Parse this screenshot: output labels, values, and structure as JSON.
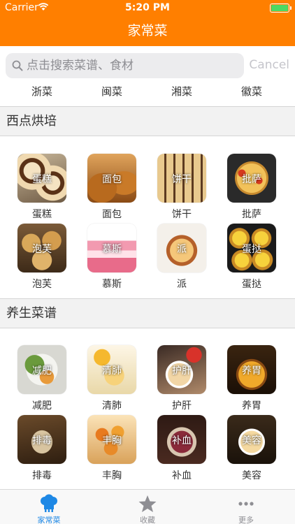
{
  "status": {
    "carrier": "Carrier",
    "time": "5:20 PM"
  },
  "nav": {
    "title": "家常菜"
  },
  "search": {
    "placeholder": "点击搜索菜谱、食材",
    "cancel": "Cancel"
  },
  "cuisines": [
    "浙菜",
    "闽菜",
    "湘菜",
    "徽菜"
  ],
  "sections": [
    {
      "title": "西点烘培",
      "items": [
        {
          "label": "蛋糕",
          "overlay": "蛋糕"
        },
        {
          "label": "面包",
          "overlay": "面包"
        },
        {
          "label": "饼干",
          "overlay": "饼干"
        },
        {
          "label": "批萨",
          "overlay": "批萨"
        },
        {
          "label": "泡芙",
          "overlay": "泡芙"
        },
        {
          "label": "慕斯",
          "overlay": "慕斯"
        },
        {
          "label": "派",
          "overlay": "派"
        },
        {
          "label": "蛋挞",
          "overlay": "蛋挞"
        }
      ]
    },
    {
      "title": "养生菜谱",
      "items": [
        {
          "label": "减肥",
          "overlay": "减肥"
        },
        {
          "label": "清肺",
          "overlay": "清肺"
        },
        {
          "label": "护肝",
          "overlay": "护肝"
        },
        {
          "label": "养胃",
          "overlay": "养胃"
        },
        {
          "label": "排毒",
          "overlay": "排毒"
        },
        {
          "label": "丰胸",
          "overlay": "丰胸"
        },
        {
          "label": "补血",
          "overlay": "补血"
        },
        {
          "label": "美容",
          "overlay": "美容"
        }
      ]
    }
  ],
  "tabs": [
    {
      "label": "家常菜",
      "icon": "chef-hat-icon"
    },
    {
      "label": "收藏",
      "icon": "star-icon"
    },
    {
      "label": "更多",
      "icon": "more-dots-icon"
    }
  ],
  "colors": {
    "accent": "#ff7f00",
    "tab_active": "#1e88e5",
    "tab_inactive": "#8e8e93"
  }
}
